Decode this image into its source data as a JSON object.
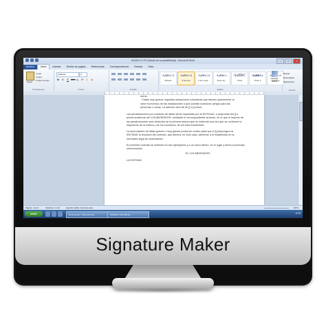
{
  "window": {
    "title": "MODELO CPS [Modo de compatibilidad] - Microsoft Word",
    "tabs": [
      "Archivo",
      "Inicio",
      "Insertar",
      "Diseño de página",
      "Referencias",
      "Correspondencia",
      "Revisar",
      "Vista"
    ],
    "active_tab": "Inicio"
  },
  "ribbon": {
    "paste_label": "Pegar",
    "clipboard_items": [
      "Cortar",
      "Copiar",
      "Copiar formato"
    ],
    "font_name": "Verdana",
    "font_size": "9",
    "group_labels": [
      "Portapapeles",
      "Fuente",
      "Párrafo",
      "Estilos",
      "Edición"
    ],
    "styles": [
      {
        "sample": "AaBbCcI",
        "name": "Énfasis"
      },
      {
        "sample": "AaBbCcI",
        "name": "¶ Normal"
      },
      {
        "sample": "AaBbCcI",
        "name": "¶ Sin espa..."
      },
      {
        "sample": "AaBbCc",
        "name": "Texto sin..."
      },
      {
        "sample": "AaBbC",
        "name": "Título"
      },
      {
        "sample": "AaBbCc",
        "name": "Título 1"
      },
      {
        "sample": "AaBbCcI",
        "name": "Subtítulo"
      }
    ],
    "change_styles_label": "Cambiar estilos",
    "edit_items": [
      "Buscar",
      "Reemplazar",
      "Seleccionar"
    ]
  },
  "document": {
    "bullet_lines": [
      "euros.",
      "- Faltas muy graves: Aquellas actuaciones voluntarias que afecten gravemente al",
      "valor económico de las instalaciones o que puedan ocasionar peligro para las",
      "personas o cosas. La sanción será de de [] a [] euros."
    ],
    "p1": "Las penalizaciones por comisión de faltas serán impuestas por la ENTIDAD, a propuesta del [] a previa audiencia del COLABORADOR, mediante el correspondiente acuerdo, en el que el importe de las penalizaciones será deducido de la primera factura que se extienda una vez que se conforme la imposición de la misma o de los sucesivos, de ser ésta insuficiente.",
    "p2": "La acumulación de faltas graves o muy graves podrá ser motivo para que el [] proponga a la ENTIDAD la rescisión del contrato, que deberá, en todo caso, atenerse a lo establecido en la normativa legal de contratación.",
    "p3": "El presente contrato se extiende en dos ejemplares y a un único efecto, en el lugar y fecha al principio mencionados.",
    "sign_left": "LA ENTIDAD",
    "sign_right": "EL COLABORADOR,"
  },
  "status": {
    "page": "Página: 4 de 6",
    "words": "Palabras: 1.413",
    "language": "Español (alfab. internacional)",
    "zoom": "100%"
  },
  "taskbar": {
    "start": "Inicio",
    "buttons": [
      "Documento1 - Microsoft Wo...",
      "MODELO CPS [Modo..."
    ],
    "clock": "11:09"
  },
  "bezel": {
    "label": "Signature Maker"
  },
  "colors": {
    "ribbon_accent": "#2b579a",
    "signature_ink": "#3f5fb0",
    "taskbar": "#2a5288"
  }
}
